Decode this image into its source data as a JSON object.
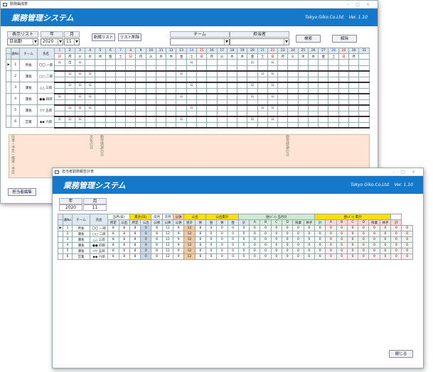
{
  "w1": {
    "title": "勤務編成表",
    "app": "業務管理システム",
    "company": "Tokyo Giko.Co.Ltd.",
    "version": "Ver. 1.10",
    "labels": {
      "list": "表示リスト",
      "year": "年",
      "month": "月",
      "team": "チーム",
      "person": "担当者",
      "dayhdr": "日"
    },
    "list_value": "日出勤",
    "year_value": "2020",
    "month_value": "11",
    "buttons": {
      "newlist": "新規リスト",
      "dellist": "リスト削除",
      "search": "検索",
      "clear": "解除",
      "edit": "担当者編集"
    },
    "days": [
      "1",
      "2",
      "3",
      "4",
      "5",
      "6",
      "7",
      "8",
      "9",
      "10",
      "11",
      "12",
      "13",
      "14",
      "15",
      "16",
      "17",
      "18",
      "19",
      "20",
      "21",
      "22",
      "23",
      "24",
      "25",
      "26",
      "27",
      "28",
      "29",
      "30",
      "31"
    ],
    "dows": [
      "日",
      "月",
      "火",
      "水",
      "木",
      "金",
      "土",
      "日",
      "月",
      "火",
      "水",
      "木",
      "金",
      "土",
      "日",
      "月",
      "火",
      "水",
      "木",
      "金",
      "土",
      "日",
      "月",
      "火",
      "水",
      "木",
      "金",
      "土",
      "日",
      "月",
      ""
    ],
    "cols": {
      "no": "通No.",
      "team": "チーム",
      "name": "氏名"
    },
    "rows": [
      {
        "no": "1",
        "team": "所長",
        "name": "〇〇 一郎",
        "marks": {
          "1": "公",
          "2": "出",
          "3": "公",
          "14": "公",
          "20": "公",
          "22": "公"
        }
      },
      {
        "no": "2",
        "team": "課長",
        "name": "□□ 二郎",
        "marks": {
          "2": "公",
          "3": "公",
          "4": "公",
          "13": "公",
          "21": "公",
          "22": "公"
        }
      },
      {
        "no": "3",
        "team": "課長",
        "name": "△△ 三郎",
        "marks": {
          "2": "公",
          "3": "公",
          "4": "公",
          "14": "公",
          "20": "公",
          "22": "公"
        }
      },
      {
        "no": "4",
        "team": "課長",
        "name": "●● 四郎",
        "marks": {
          "1": "公",
          "3": "公",
          "4": "公",
          "13": "公",
          "20": "公",
          "22": "公"
        }
      },
      {
        "no": "5",
        "team": "課長",
        "name": "▽▽ 五郎",
        "marks": {
          "2": "公",
          "3": "公",
          "4": "公",
          "14": "公",
          "21": "公",
          "22": "公"
        }
      },
      {
        "no": "6",
        "team": "営業",
        "name": "◆◆ 六郎",
        "marks": {
          "1": "公",
          "2": "公",
          "3": "公",
          "13": "公",
          "20": "公",
          "22": "公"
        }
      }
    ],
    "notes_label": "行事・予定・備考・予定",
    "event1": "文化の日",
    "event2": "勤労感謝の日",
    "event3": "勤労感謝の日"
  },
  "w2": {
    "title": "担当者勤務報告計表",
    "app": "業務管理システム",
    "company": "Tokyo Giko.Co.Ltd.",
    "version": "Ver. 1.10",
    "year_label": "年",
    "month_label": "月",
    "year": "2020",
    "month": "11",
    "close": "閉じる",
    "groups": [
      "当月(日)",
      "累計(日)",
      "前月",
      "次月",
      "公休",
      "公出",
      "公出累計",
      "昼(ﾊﾞﾄ) 当月計",
      "昼(ﾊﾞﾄ) 累計"
    ],
    "sub": [
      "所定",
      "公出",
      "所定",
      "公出",
      "公休",
      "公休",
      "公休",
      "昼計",
      "休",
      "昼",
      "休",
      "昼",
      "計",
      "A",
      "B",
      "C",
      "D",
      "残業",
      "休手",
      "計",
      "A",
      "B",
      "C",
      "D",
      "残業",
      "休手",
      "計"
    ],
    "cols": {
      "no": "通No.",
      "team": "チーム",
      "name": "氏名"
    },
    "rows": [
      {
        "no": "1",
        "team": "所長",
        "name": "〇〇 一郎",
        "v": [
          "8",
          "8",
          "8",
          "0",
          "8",
          "12",
          "9",
          "12",
          "8",
          "0",
          "0",
          "0",
          "0",
          "0",
          "0",
          "0",
          "0",
          "0",
          "0",
          "0",
          "0",
          "0",
          "0",
          "0",
          "0",
          "0",
          "0",
          "0"
        ]
      },
      {
        "no": "2",
        "team": "課長",
        "name": "□□ 二郎",
        "v": [
          "8",
          "8",
          "8",
          "0",
          "8",
          "12",
          "9",
          "12",
          "8",
          "0",
          "0",
          "0",
          "0",
          "0",
          "0",
          "0",
          "0",
          "0",
          "0",
          "0",
          "0",
          "0",
          "0",
          "0",
          "0",
          "0",
          "0",
          "0"
        ]
      },
      {
        "no": "3",
        "team": "課長",
        "name": "△△ 三郎",
        "v": [
          "8",
          "8",
          "8",
          "0",
          "8",
          "12",
          "9",
          "12",
          "8",
          "0",
          "0",
          "0",
          "0",
          "0",
          "0",
          "0",
          "0",
          "0",
          "0",
          "0",
          "0",
          "0",
          "0",
          "0",
          "0",
          "0",
          "0",
          "0"
        ]
      },
      {
        "no": "4",
        "team": "課長",
        "name": "●● 四郎",
        "v": [
          "8",
          "8",
          "8",
          "0",
          "8",
          "12",
          "9",
          "12",
          "8",
          "0",
          "0",
          "0",
          "0",
          "0",
          "0",
          "0",
          "0",
          "0",
          "0",
          "0",
          "0",
          "0",
          "0",
          "0",
          "0",
          "0",
          "0",
          "0"
        ]
      },
      {
        "no": "5",
        "team": "課長",
        "name": "▽▽ 五郎",
        "v": [
          "8",
          "8",
          "8",
          "0",
          "8",
          "12",
          "9",
          "12",
          "8",
          "0",
          "0",
          "0",
          "0",
          "0",
          "0",
          "0",
          "0",
          "0",
          "0",
          "0",
          "0",
          "0",
          "0",
          "0",
          "0",
          "0",
          "0",
          "0"
        ]
      },
      {
        "no": "6",
        "team": "営業",
        "name": "◆◆ 六郎",
        "v": [
          "8",
          "8",
          "8",
          "0",
          "8",
          "12",
          "9",
          "12",
          "8",
          "0",
          "0",
          "0",
          "0",
          "0",
          "0",
          "0",
          "0",
          "0",
          "0",
          "0",
          "0",
          "0",
          "0",
          "0",
          "0",
          "0",
          "0",
          "0"
        ]
      }
    ]
  }
}
